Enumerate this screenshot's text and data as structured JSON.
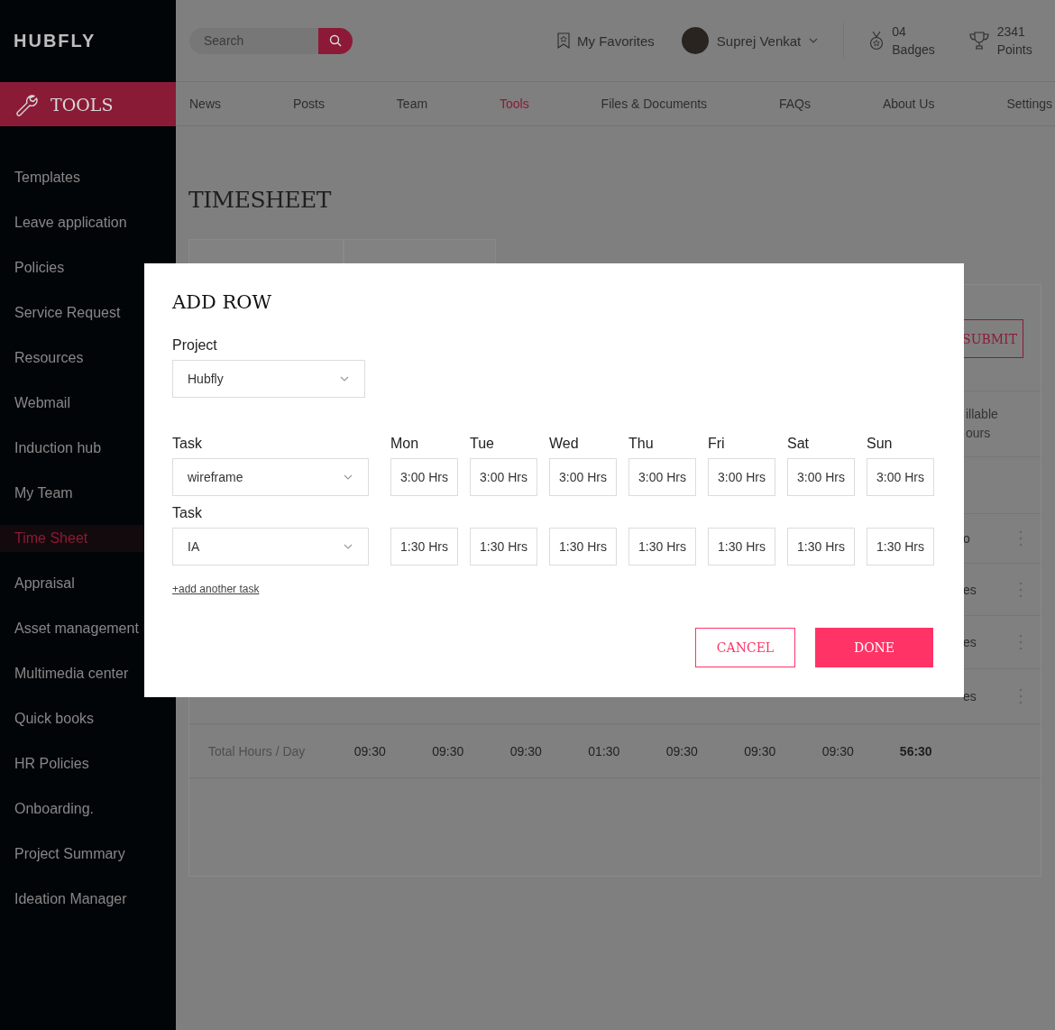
{
  "sidebar": {
    "logo": "HUBFLY",
    "section": {
      "label": "TOOLS"
    },
    "items": [
      {
        "label": "Templates",
        "selected": false
      },
      {
        "label": "Leave application",
        "selected": false
      },
      {
        "label": "Policies",
        "selected": false
      },
      {
        "label": "Service Request",
        "selected": false
      },
      {
        "label": "Resources",
        "selected": false
      },
      {
        "label": "Webmail",
        "selected": false
      },
      {
        "label": "Induction hub",
        "selected": false
      },
      {
        "label": "My Team",
        "selected": false
      },
      {
        "label": "Time Sheet",
        "selected": true
      },
      {
        "label": "Appraisal",
        "selected": false
      },
      {
        "label": "Asset management",
        "selected": false
      },
      {
        "label": "Multimedia center",
        "selected": false
      },
      {
        "label": "Quick books",
        "selected": false
      },
      {
        "label": "HR Policies",
        "selected": false
      },
      {
        "label": "Onboarding.",
        "selected": false
      },
      {
        "label": "Project Summary",
        "selected": false
      },
      {
        "label": "Ideation Manager",
        "selected": false
      }
    ]
  },
  "header": {
    "search": {
      "placeholder": "Search"
    },
    "favorites": "My Favorites",
    "user": {
      "name": "Suprej Venkat"
    },
    "badges": {
      "count": "04",
      "label": "Badges"
    },
    "points": {
      "count": "2341",
      "label": "Points"
    }
  },
  "nav": [
    {
      "label": "News",
      "selected": false
    },
    {
      "label": "Posts",
      "selected": false
    },
    {
      "label": "Team",
      "selected": false
    },
    {
      "label": "Tools",
      "selected": true
    },
    {
      "label": "Files & Documents",
      "selected": false
    },
    {
      "label": "FAQs",
      "selected": false
    },
    {
      "label": "About Us",
      "selected": false
    },
    {
      "label": "Settings",
      "selected": false
    }
  ],
  "page": {
    "title": "TIMESHEET",
    "submit": "SUBMIT",
    "column_fragment": "illable ours",
    "row_fragments": [
      "o",
      "es",
      "es",
      "es"
    ],
    "total": {
      "label": "Total Hours / Day",
      "values": [
        "09:30",
        "09:30",
        "09:30",
        "01:30",
        "09:30",
        "09:30",
        "09:30"
      ],
      "sum": "56:30"
    }
  },
  "modal": {
    "title": "ADD ROW",
    "project": {
      "label": "Project",
      "value": "Hubfly"
    },
    "days": [
      "Mon",
      "Tue",
      "Wed",
      "Thu",
      "Fri",
      "Sat",
      "Sun"
    ],
    "tasks": [
      {
        "label": "Task",
        "value": "wireframe",
        "hours": [
          "3:00 Hrs",
          "3:00 Hrs",
          "3:00 Hrs",
          "3:00 Hrs",
          "3:00 Hrs",
          "3:00 Hrs",
          "3:00 Hrs"
        ]
      },
      {
        "label": "Task",
        "value": "IA",
        "hours": [
          "1:30 Hrs",
          "1:30 Hrs",
          "1:30 Hrs",
          "1:30 Hrs",
          "1:30 Hrs",
          "1:30 Hrs",
          "1:30 Hrs"
        ]
      }
    ],
    "add_link": "+add another task",
    "buttons": [
      {
        "label": "CANCEL",
        "kind": "outline"
      },
      {
        "label": "DONE",
        "kind": "primary"
      }
    ]
  }
}
